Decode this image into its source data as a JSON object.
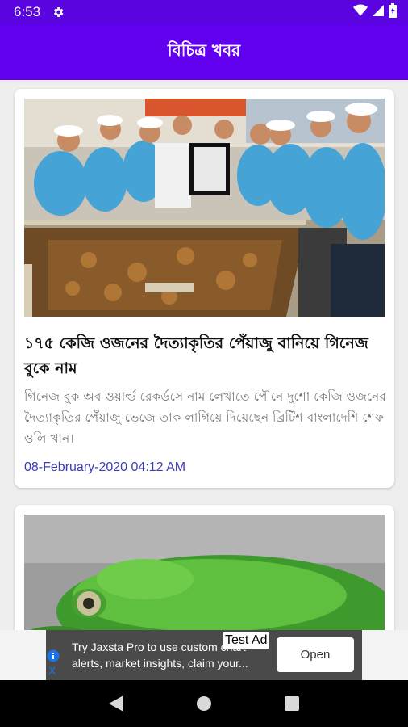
{
  "status_bar": {
    "time": "6:53",
    "icons": [
      "gear-icon",
      "wifi-icon",
      "signal-icon",
      "battery-icon"
    ]
  },
  "app_bar": {
    "title": "বিচিত্র খবর",
    "color": "#6100ee"
  },
  "articles": [
    {
      "headline": "১৭৫ কেজি ওজনের দৈত্যাকৃতির পেঁয়াজু বানিয়ে গিনেজ বুকে নাম",
      "summary": "গিনেজ বুক অব ওয়ার্ল্ড রেকর্ডসে নাম লেখাতে পৌনে দুশো কেজি ওজনের দৈত্যাকৃতির পেঁয়াজু ভেজে তাক লাগিয়ে দিয়েছেন ব্রিটিশ বাংলাদেশি শেফ ওলি খান।",
      "date": "08-February-2020 04:12 AM"
    },
    {
      "headline": "",
      "summary": "",
      "date": ""
    }
  ],
  "ad": {
    "text": "Try Jaxsta Pro to use custom chart alerts, market insights, claim your...",
    "test_label": "Test Ad",
    "button_label": "Open",
    "close_label": "X"
  },
  "nav": {
    "icons": [
      "back-icon",
      "home-icon",
      "recents-icon"
    ]
  },
  "colors": {
    "status_bar": "#5a05e0",
    "accent": "#6100ee",
    "date_text": "#3b3bb5"
  }
}
